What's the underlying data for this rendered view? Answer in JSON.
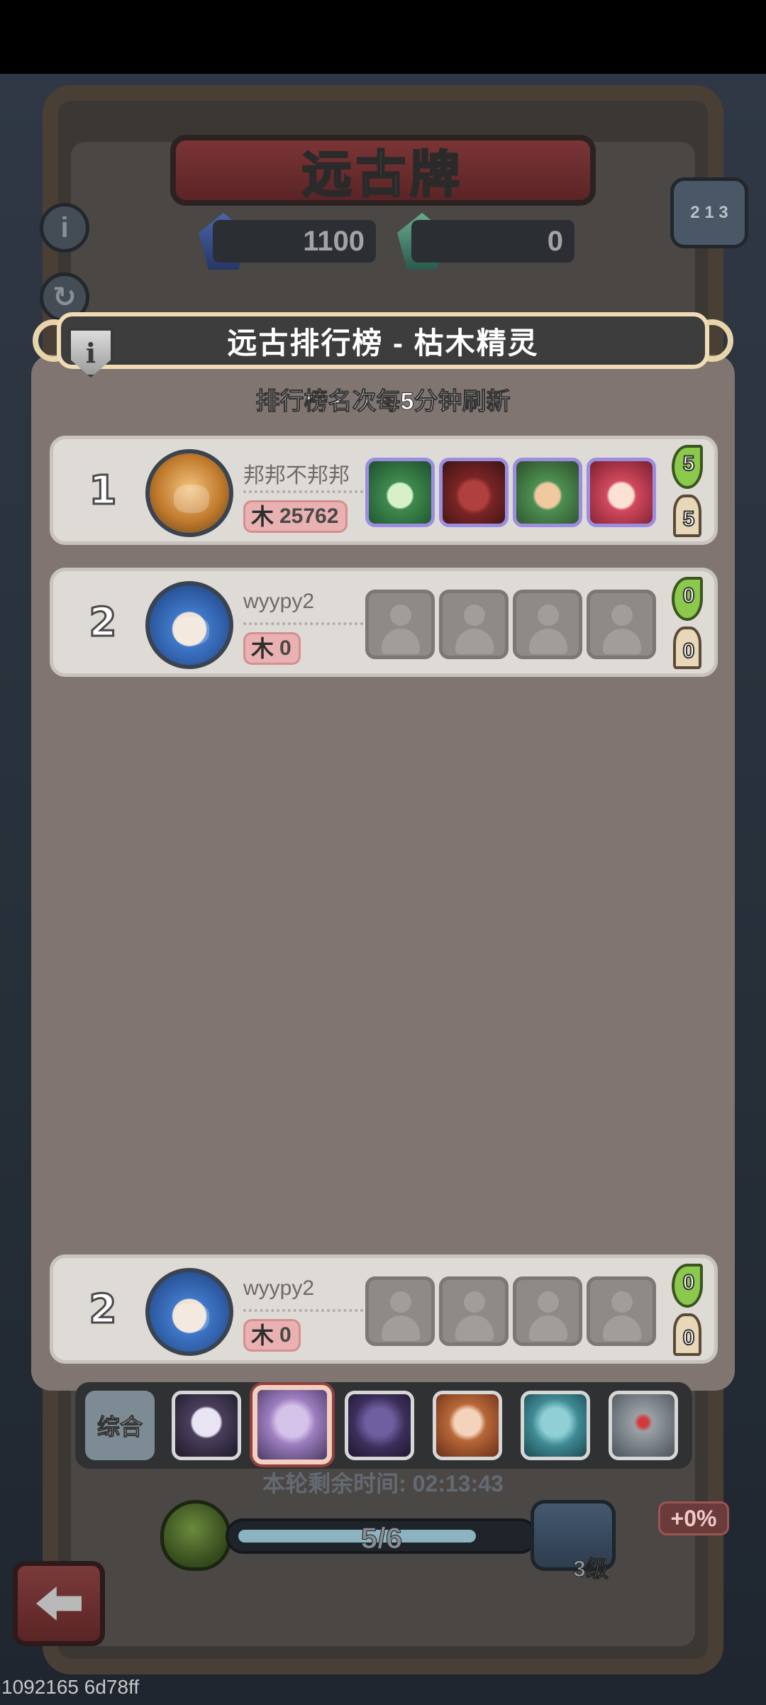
{
  "header": {
    "title": "远古牌",
    "currency_blue": "1100",
    "currency_green": "0"
  },
  "panel": {
    "title": "远古排行榜 - 枯木精灵",
    "subtitle": "排行榜名次每5分钟刷新"
  },
  "rows": [
    {
      "rank": "1",
      "name": "邦邦不邦邦",
      "score": "25762",
      "stat_top": "5",
      "stat_bottom": "5"
    },
    {
      "rank": "2",
      "name": "wyypy2",
      "score": "0",
      "stat_top": "0",
      "stat_bottom": "0"
    }
  ],
  "self_row": {
    "rank": "2",
    "name": "wyypy2",
    "score": "0",
    "stat_top": "0",
    "stat_bottom": "0"
  },
  "tabs": {
    "all_label": "综合"
  },
  "footer": {
    "timer": "本轮剩余时间: 02:13:43",
    "progress_text": "5/6",
    "progress_fraction": 0.83,
    "chest_level": "3级",
    "bonus": "+0%"
  },
  "debug": "1092165 6d78ff",
  "icons": {
    "info": "info-icon",
    "refresh": "refresh-icon",
    "leaderboard": "podium-icon",
    "back": "back-arrow-icon",
    "score": "tower-icon"
  }
}
